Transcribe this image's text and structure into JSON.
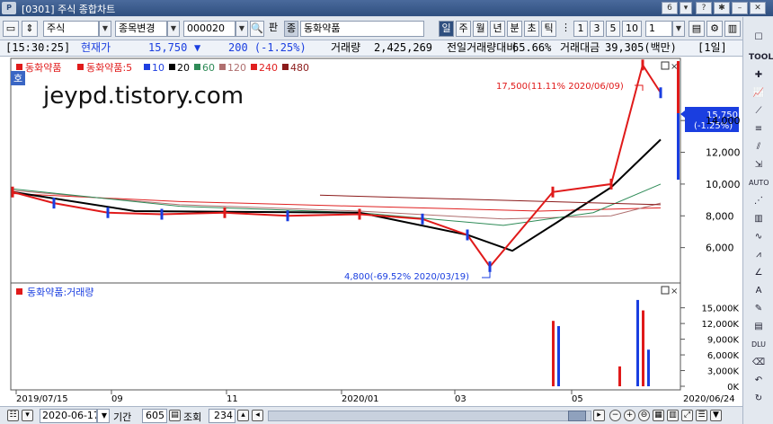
{
  "window": {
    "title": "[0301] 주식 종합차트",
    "tab_number": "6",
    "app_icon": "P"
  },
  "toolbar": {
    "market": "주식",
    "code_mode": "종목변경",
    "code": "000020",
    "pan_label": "판",
    "jong_label": "종",
    "stock_name": "동화약품",
    "periods": [
      "일",
      "주",
      "월",
      "년",
      "분",
      "초",
      "틱"
    ],
    "active_period": "일",
    "intervals": [
      "1",
      "3",
      "5",
      "10"
    ],
    "interval_value": "1"
  },
  "infobar": {
    "time": "[15:30:25]",
    "price_label": "현재가",
    "price": "15,750",
    "change_arrow": "▼",
    "change": "200 (-1.25%)",
    "volume_label": "거래량",
    "volume": "2,425,269",
    "prev_ratio_label": "전일거래량대비",
    "prev_ratio": "65.66%",
    "amount_label": "거래대금",
    "amount": "39,305(백만)",
    "period_badge": "[1일]"
  },
  "price_panel": {
    "legend": {
      "main": "동화약품",
      "ma_prefix": "동화약품:5",
      "ma": [
        {
          "label": "10",
          "color": "#1f3fe0"
        },
        {
          "label": "20",
          "color": "#000000"
        },
        {
          "label": "60",
          "color": "#2e8b57"
        },
        {
          "label": "120",
          "color": "#b07070"
        },
        {
          "label": "240",
          "color": "#e02020"
        },
        {
          "label": "480",
          "color": "#8b1a1a"
        }
      ]
    },
    "ho_badge": "호",
    "watermark": "jeypd.tistory.com",
    "high_annotation": "17,500(11.11% 2020/06/09)",
    "low_annotation": "4,800(-69.52% 2020/03/19)",
    "current_price_tag": "15,750",
    "current_change_tag": "(-1.25%)",
    "y_ticks": [
      "14,000",
      "12,000",
      "10,000",
      "8,000",
      "6,000"
    ]
  },
  "volume_panel": {
    "legend": "동화약품:거래량",
    "y_ticks": [
      "15,000K",
      "12,000K",
      "9,000K",
      "6,000K",
      "3,000K",
      "0K"
    ]
  },
  "x_axis": {
    "labels": [
      "2019/07/15",
      "09",
      "11",
      "2020/01",
      "03",
      "05"
    ],
    "end_label": "2020/06/24"
  },
  "bottombar": {
    "date": "2020-06-17",
    "period_label": "기간",
    "period_value": "605",
    "query_label": "조회",
    "query_value": "234"
  },
  "chart_data": {
    "type": "line",
    "title": "",
    "series": [
      {
        "name": "동화약품",
        "x": [
          "2019/07",
          "2019/08",
          "2019/09",
          "2019/10",
          "2019/11",
          "2019/12",
          "2020/01",
          "2020/02",
          "2020/03",
          "2020/03/19",
          "2020/04",
          "2020/05",
          "2020/06/09",
          "2020/06/24"
        ],
        "values": [
          9500,
          8800,
          8200,
          8100,
          8200,
          8000,
          8100,
          7800,
          6800,
          4800,
          9500,
          10000,
          17500,
          15750
        ]
      },
      {
        "name": "동화약품:거래량",
        "x": [
          "2020/04",
          "2020/04",
          "2020/05",
          "2020/06",
          "2020/06",
          "2020/06"
        ],
        "values": [
          12500,
          11500,
          3800,
          16500,
          14500,
          7000
        ]
      }
    ],
    "ylim": [
      4000,
      17800
    ],
    "volume_ylim": [
      0,
      17000
    ]
  }
}
